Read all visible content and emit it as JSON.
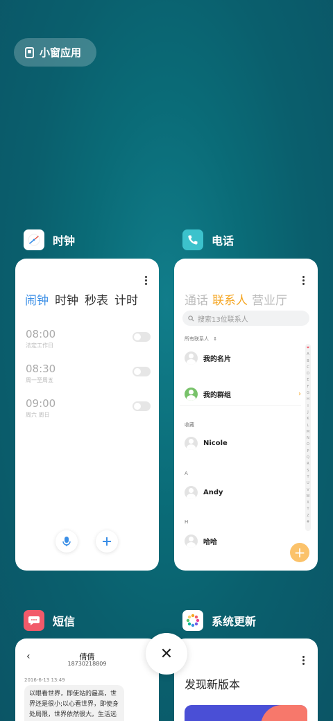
{
  "floating_pill": {
    "label": "小窗应用",
    "icon": "small-window-icon"
  },
  "clock_app": {
    "name": "时钟",
    "icon": "clock-app-icon",
    "tabs": [
      "闹钟",
      "时钟",
      "秒表",
      "计时"
    ],
    "active_tab": "闹钟",
    "alarms": [
      {
        "time": "08:00",
        "repeat": "法定工作日",
        "enabled": false
      },
      {
        "time": "08:30",
        "repeat": "周一至周五",
        "enabled": false
      },
      {
        "time": "09:00",
        "repeat": "周六 周日",
        "enabled": false
      }
    ],
    "voice_icon": "microphone-icon",
    "add_icon": "plus-icon"
  },
  "phone_app": {
    "name": "电话",
    "icon": "phone-app-icon",
    "tabs": [
      "通话",
      "联系人",
      "营业厅"
    ],
    "active_tab": "联系人",
    "search_placeholder": "搜索13位联系人",
    "all_contacts_label": "所有联系人",
    "sort_arrow": "⇕",
    "my_card": "我的名片",
    "my_groups": "我的群组",
    "group_chevron": "›",
    "favorites_label": "收藏",
    "sections": [
      {
        "header": "",
        "contact": "Nicole"
      },
      {
        "header": "A",
        "contact": "Andy"
      },
      {
        "header": "H",
        "contact": "哈哈"
      }
    ],
    "alphabet": [
      "❤",
      "A",
      "B",
      "C",
      "D",
      "E",
      "F",
      "G",
      "H",
      "I",
      "J",
      "K",
      "L",
      "M",
      "N",
      "O",
      "P",
      "Q",
      "R",
      "S",
      "T",
      "U",
      "V",
      "W",
      "X",
      "Y",
      "Z",
      "#"
    ],
    "colors": {
      "accent": "#f5a623"
    }
  },
  "sms_app": {
    "name": "短信",
    "icon": "sms-app-icon",
    "contact_name": "倩倩",
    "contact_number": "18730218809",
    "back_icon": "‹",
    "message_date": "2016-6-13 13:49",
    "message_text": "以眼看世界，即使站的最高，世界还是很小;以心看世界，即使身处局限，世界依然很大。生活远不完美，需要用心去体会;正把握在人"
  },
  "update_app": {
    "name": "系统更新",
    "icon": "system-update-icon",
    "headline": "发现新版本"
  },
  "close_button": {
    "icon": "close-icon",
    "glyph": "✕"
  }
}
